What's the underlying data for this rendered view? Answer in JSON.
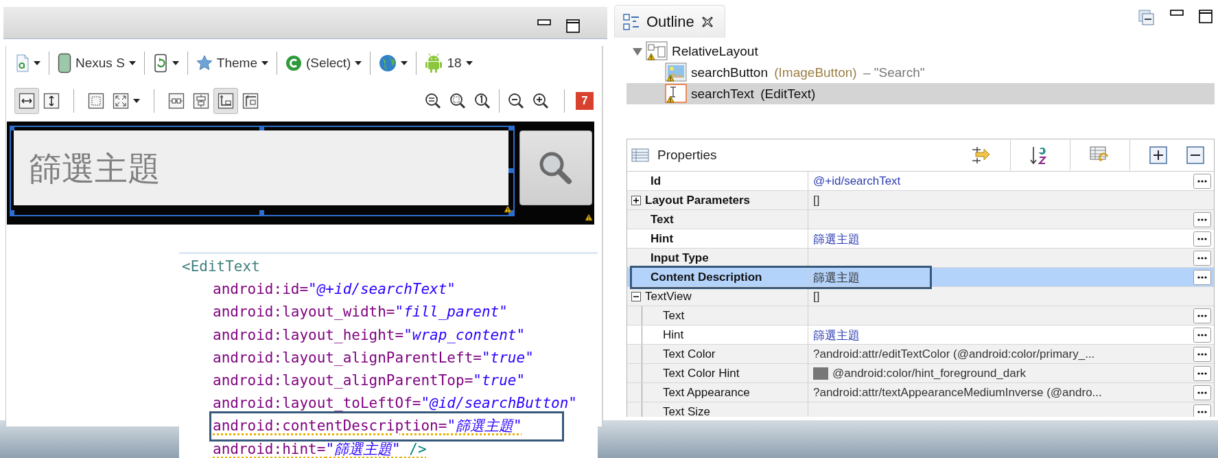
{
  "editor": {
    "config_toolbar": [
      {
        "dropdown": true
      },
      {
        "label": "Nexus S",
        "dropdown": true
      },
      {
        "dropdown": true
      },
      {
        "label": "Theme",
        "dropdown": true
      },
      {
        "label": "(Select)",
        "dropdown": true
      },
      {
        "dropdown": true
      },
      {
        "label": "18",
        "dropdown": true
      }
    ],
    "layout_toolbar": [
      {
        "selected": true,
        "dropdown": false
      },
      {
        "selected": false,
        "dropdown": false
      },
      {
        "selected": false,
        "dropdown": false
      },
      {
        "selected": false,
        "dropdown": true
      },
      {
        "selected": false,
        "dropdown": false
      },
      {
        "selected": false,
        "dropdown": false
      },
      {
        "selected": true,
        "dropdown": false
      },
      {
        "selected": false,
        "dropdown": false
      }
    ],
    "issues_badge": "7",
    "preview": {
      "placeholder": "篩選主題",
      "selected": true,
      "warnings": true
    },
    "code": {
      "lines": [
        {
          "kind": "tag",
          "text": "<EditText"
        },
        {
          "kind": "attr",
          "name": "android:id=",
          "value": "\"@+id/searchText\"",
          "warning": false,
          "highlighted": false
        },
        {
          "kind": "attr",
          "name": "android:layout_width=",
          "value": "\"fill_parent\"",
          "warning": false,
          "highlighted": false
        },
        {
          "kind": "attr",
          "name": "android:layout_height=",
          "value": "\"wrap_content\"",
          "warning": false,
          "highlighted": false
        },
        {
          "kind": "attr",
          "name": "android:layout_alignParentLeft=",
          "value": "\"true\"",
          "warning": false,
          "highlighted": false
        },
        {
          "kind": "attr",
          "name": "android:layout_alignParentTop=",
          "value": "\"true\"",
          "warning": false,
          "highlighted": false
        },
        {
          "kind": "attr",
          "name": "android:layout_toLeftOf=",
          "value": "\"@id/searchButton\"",
          "warning": false,
          "highlighted": false
        },
        {
          "kind": "attr",
          "name": "android:contentDescription=",
          "value": "\"篩選主題\"",
          "warning": true,
          "highlighted": true
        },
        {
          "kind": "attr",
          "name": "android:hint=",
          "value": "\"篩選主題\"",
          "close": " />",
          "warning": true,
          "highlighted": false
        }
      ]
    }
  },
  "outline": {
    "tab": "Outline",
    "tree": [
      {
        "kind": "layout",
        "name": "RelativeLayout",
        "warning": true,
        "expanded": true,
        "selected": false,
        "children": [
          {
            "kind": "image_button",
            "name": "searchButton",
            "type": "(ImageButton)",
            "detail": "– \"Search\"",
            "warning": true,
            "selected": false
          },
          {
            "kind": "edit_text",
            "name": "searchText",
            "type": "(EditText)",
            "warning": true,
            "selected": true
          }
        ]
      }
    ]
  },
  "properties": {
    "title": "Properties",
    "rows": [
      {
        "kind": "property",
        "label": "Id",
        "value": "@+id/searchText",
        "modified": true,
        "selected": false,
        "highlighted": false
      },
      {
        "kind": "group",
        "label": "Layout Parameters",
        "value": "[]",
        "expanded": false,
        "modified": false,
        "selected": false,
        "highlighted": false
      },
      {
        "kind": "property",
        "label": "Text",
        "modified": false,
        "selected": false,
        "highlighted": false
      },
      {
        "kind": "property",
        "label": "Hint",
        "value": "篩選主題",
        "modified": true,
        "selected": false,
        "highlighted": false
      },
      {
        "kind": "property",
        "label": "Input Type",
        "modified": false,
        "selected": false,
        "highlighted": false
      },
      {
        "kind": "property",
        "label": "Content Description",
        "value": "篩選主題",
        "modified": false,
        "selected": true,
        "highlighted": true
      },
      {
        "kind": "category",
        "label": "TextView",
        "value": "[]",
        "expanded": true,
        "modified": false,
        "selected": false,
        "highlighted": false,
        "children": [
          {
            "kind": "property",
            "label": "Text",
            "modified": false,
            "selected": false,
            "highlighted": false
          },
          {
            "kind": "property",
            "label": "Hint",
            "value": "篩選主題",
            "modified": true,
            "selected": false,
            "highlighted": false
          },
          {
            "kind": "property",
            "label": "Text Color",
            "value": "?android:attr/editTextColor (@android:color/primary_...",
            "modified": false,
            "selected": false,
            "highlighted": false
          },
          {
            "kind": "property",
            "label": "Text Color Hint",
            "value": "@android:color/hint_foreground_dark",
            "color": "#777777",
            "modified": false,
            "selected": false,
            "highlighted": false
          },
          {
            "kind": "property",
            "label": "Text Appearance",
            "value": "?android:attr/textAppearanceMediumInverse (@andro...",
            "modified": false,
            "selected": false,
            "highlighted": false
          },
          {
            "kind": "property",
            "label": "Text Size",
            "modified": false,
            "selected": false,
            "highlighted": false
          }
        ]
      }
    ]
  }
}
